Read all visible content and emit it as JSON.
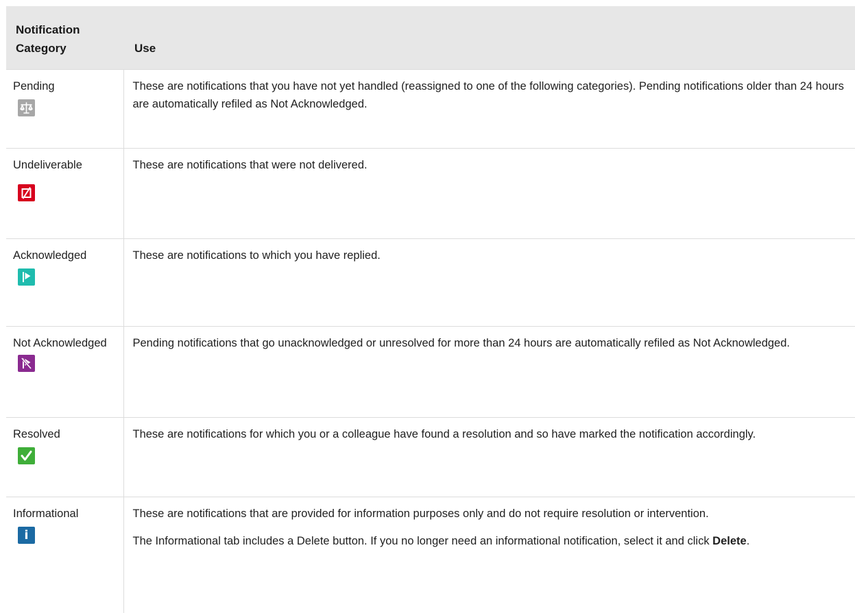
{
  "header": {
    "category": "Notification Category",
    "use": "Use"
  },
  "rows": [
    {
      "category": "Pending",
      "icon": "scales-icon",
      "use": "These are notifications that you have not yet handled (reassigned to one of the following categories). Pending notifications older than 24 hours are automatically refiled as Not Acknowledged."
    },
    {
      "category": "Undeliverable",
      "icon": "undeliverable-icon",
      "use": "These are notifications that were not delivered."
    },
    {
      "category": "Acknowledged",
      "icon": "flag-icon",
      "use": "These are notifications to which you have replied."
    },
    {
      "category": "Not Acknowledged",
      "icon": "crossed-flag-icon",
      "use": "Pending notifications that go unacknowledged or unresolved for more than 24 hours are automatically refiled as Not Acknowledged."
    },
    {
      "category": "Resolved",
      "icon": "checkmark-icon",
      "use": "These are notifications for which you or a colleague have found a resolution and so have marked the notification accordingly."
    },
    {
      "category": "Informational",
      "icon": "info-icon",
      "use": "These are notifications that are provided for information purposes only and do not require resolution or intervention.",
      "use_extra_prefix": "The Informational tab includes a Delete button. If you no longer need an informational notification, select it and click ",
      "use_extra_bold": "Delete",
      "use_extra_suffix": "."
    }
  ],
  "colors": {
    "header_bg": "#e7e7e7",
    "pending": "#a7a7a7",
    "undeliverable": "#d7001e",
    "acknowledged": "#1fbcae",
    "not_acknowledged": "#8a2a90",
    "resolved": "#3fae39",
    "informational": "#1b6aa3"
  }
}
